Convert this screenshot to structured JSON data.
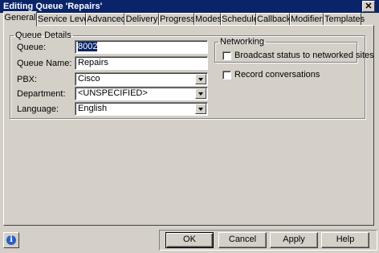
{
  "window": {
    "title": "Editing Queue 'Repairs'",
    "close_glyph": "✕"
  },
  "tabs": [
    {
      "label": "General",
      "active": true
    },
    {
      "label": "Service Level"
    },
    {
      "label": "Advanced"
    },
    {
      "label": "Delivery"
    },
    {
      "label": "Progress"
    },
    {
      "label": "Modes"
    },
    {
      "label": "Schedule"
    },
    {
      "label": "Callback"
    },
    {
      "label": "Modifiers"
    },
    {
      "label": "Templates"
    }
  ],
  "queue_details": {
    "title": "Queue Details",
    "queue": {
      "label": "Queue:",
      "value": "8002"
    },
    "queue_name": {
      "label": "Queue Name:",
      "value": "Repairs"
    },
    "pbx": {
      "label": "PBX:",
      "value": "Cisco"
    },
    "department": {
      "label": "Department:",
      "value": "<UNSPECIFIED>"
    },
    "language": {
      "label": "Language:",
      "value": "English"
    }
  },
  "networking": {
    "title": "Networking",
    "broadcast": {
      "label": "Broadcast status to networked sites",
      "checked": false
    }
  },
  "record": {
    "label": "Record conversations",
    "checked": false
  },
  "buttons": {
    "ok": "OK",
    "cancel": "Cancel",
    "apply": "Apply",
    "help": "Help",
    "info_glyph": "i"
  },
  "colors": {
    "titlebar": "#0a246a",
    "face": "#d4d0c8",
    "selection": "#0a246a"
  }
}
